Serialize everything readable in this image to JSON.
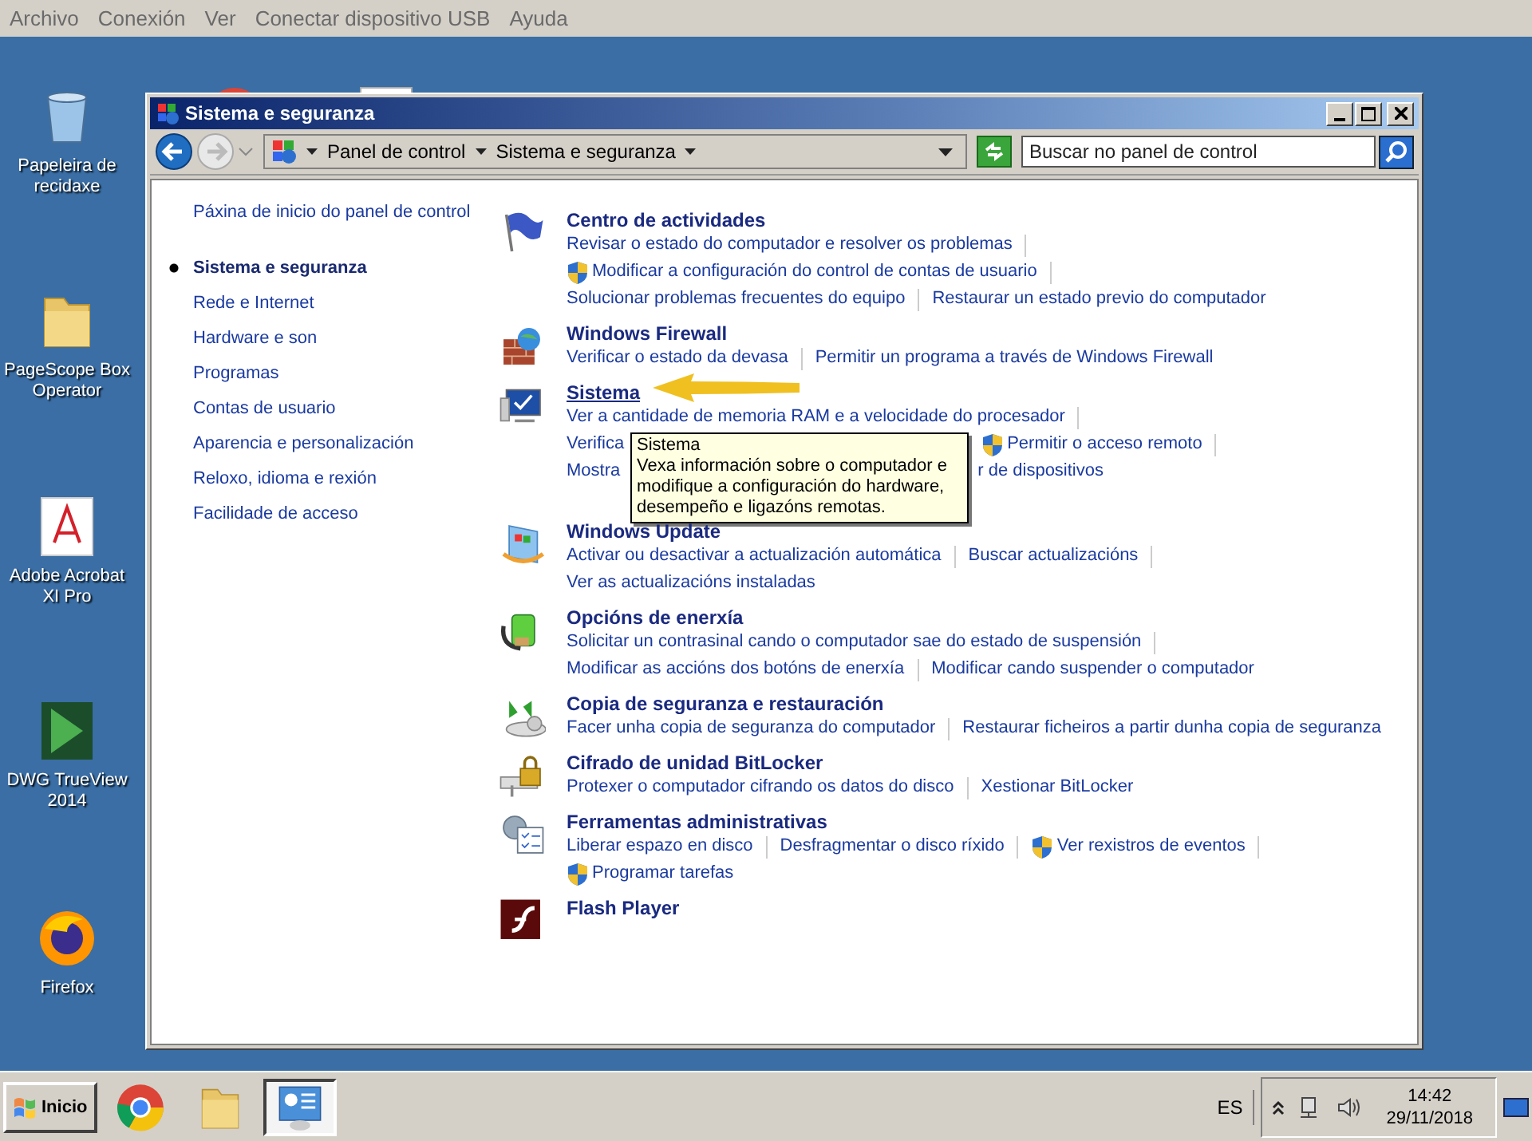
{
  "host_menu": [
    "Archivo",
    "Conexión",
    "Ver",
    "Conectar dispositivo USB",
    "Ayuda"
  ],
  "desktop_icons": [
    {
      "label": "Papeleira de recidaxe"
    },
    {
      "label": "PageScope Box Operator"
    },
    {
      "label": "Adobe Acrobat XI Pro"
    },
    {
      "label": "DWG TrueView 2014"
    },
    {
      "label": "Firefox"
    }
  ],
  "window": {
    "title": "Sistema e seguranza",
    "breadcrumb": [
      "Panel de control",
      "Sistema e seguranza"
    ],
    "search": {
      "placeholder": "Buscar no panel de control"
    },
    "sidebar": {
      "home_link": "Páxina de inicio do panel de control",
      "items": [
        {
          "label": "Sistema e seguranza",
          "selected": true
        },
        {
          "label": "Rede e Internet",
          "selected": false
        },
        {
          "label": "Hardware e son",
          "selected": false
        },
        {
          "label": "Programas",
          "selected": false
        },
        {
          "label": "Contas de usuario",
          "selected": false
        },
        {
          "label": "Aparencia e personalización",
          "selected": false
        },
        {
          "label": "Reloxo, idioma e rexión",
          "selected": false
        },
        {
          "label": "Facilidade de acceso",
          "selected": false
        }
      ]
    },
    "sections": [
      {
        "title": "Centro de actividades",
        "hovered": false,
        "rows": [
          [
            {
              "text": "Revisar o estado do computador e resolver os problemas",
              "shield": false
            }
          ],
          [
            {
              "text": "Modificar a configuración do control de contas de usuario",
              "shield": true
            }
          ],
          [
            {
              "text": "Solucionar problemas frecuentes do equipo",
              "shield": false
            },
            {
              "text": "Restaurar un estado previo do computador",
              "shield": false
            }
          ]
        ]
      },
      {
        "title": "Windows Firewall",
        "hovered": false,
        "rows": [
          [
            {
              "text": "Verificar o estado da devasa",
              "shield": false
            },
            {
              "text": "Permitir un programa a través de Windows Firewall",
              "shield": false
            }
          ]
        ]
      },
      {
        "title": "Sistema",
        "hovered": true,
        "rows": [
          [
            {
              "text": "Ver a cantidade de memoria RAM e a velocidade do procesador",
              "shield": false
            }
          ],
          [
            {
              "text": "Verifica",
              "shield": false
            },
            {
              "text": "Permitir o acceso remoto",
              "shield": true
            }
          ],
          [
            {
              "text": "Mostra",
              "shield": false
            },
            {
              "text": "r de dispositivos",
              "shield": false
            }
          ]
        ]
      },
      {
        "title": "Windows Update",
        "hovered": false,
        "rows": [
          [
            {
              "text": "Activar ou desactivar a actualización automática",
              "shield": false
            },
            {
              "text": "Buscar actualizacións",
              "shield": false
            }
          ],
          [
            {
              "text": "Ver as actualizacións instaladas",
              "shield": false
            }
          ]
        ]
      },
      {
        "title": "Opcións de enerxía",
        "hovered": false,
        "rows": [
          [
            {
              "text": "Solicitar un contrasinal cando o computador sae do estado de suspensión",
              "shield": false
            }
          ],
          [
            {
              "text": "Modificar as accións dos botóns de enerxía",
              "shield": false
            },
            {
              "text": "Modificar cando suspender o computador",
              "shield": false
            }
          ]
        ]
      },
      {
        "title": "Copia de seguranza e restauración",
        "hovered": false,
        "rows": [
          [
            {
              "text": "Facer unha copia de seguranza do computador",
              "shield": false
            },
            {
              "text": "Restaurar ficheiros a partir dunha copia de seguranza",
              "shield": false
            }
          ]
        ]
      },
      {
        "title": "Cifrado de unidad BitLocker",
        "hovered": false,
        "rows": [
          [
            {
              "text": "Protexer o computador cifrando os datos do disco",
              "shield": false
            },
            {
              "text": "Xestionar BitLocker",
              "shield": false
            }
          ]
        ]
      },
      {
        "title": "Ferramentas administrativas",
        "hovered": false,
        "rows": [
          [
            {
              "text": "Liberar espazo en disco",
              "shield": false
            },
            {
              "text": "Desfragmentar o disco ríxido",
              "shield": false
            },
            {
              "text": "Ver rexistros de eventos",
              "shield": true
            }
          ],
          [
            {
              "text": "Programar tarefas",
              "shield": true
            }
          ]
        ]
      },
      {
        "title": "Flash Player",
        "hovered": false
      }
    ],
    "tooltip": {
      "title": "Sistema",
      "text": "Vexa información sobre o computador e modifique a configuración do hardware, desempeño e ligazóns remotas."
    }
  },
  "taskbar": {
    "start": "Inicio",
    "apps": [
      {
        "selected": false
      },
      {
        "selected": false
      },
      {
        "selected": true
      }
    ],
    "language": "ES",
    "time": "14:42",
    "date": "29/11/2018"
  }
}
